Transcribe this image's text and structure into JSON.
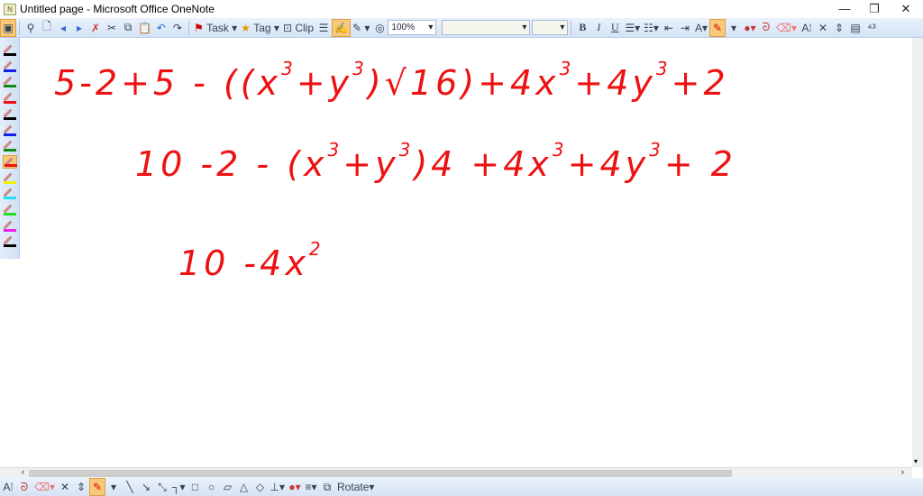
{
  "window": {
    "title": "Untitled page - Microsoft Office OneNote",
    "minimize": "—",
    "restore": "❐",
    "close": "✕"
  },
  "toolbar": {
    "task_label": "Task",
    "tag_label": "Tag",
    "clip_label": "Clip",
    "zoom_value": "100%",
    "font_value": "",
    "size_value": "",
    "bold": "B",
    "italic": "I",
    "underline": "U"
  },
  "pens": [
    {
      "color": "#000000"
    },
    {
      "color": "#1a1aee"
    },
    {
      "color": "#118811"
    },
    {
      "color": "#ee1111"
    },
    {
      "color": "#000000"
    },
    {
      "color": "#1a1aee"
    },
    {
      "color": "#118811"
    },
    {
      "color": "#ee1111",
      "selected": true
    },
    {
      "color": "#f0f000"
    },
    {
      "color": "#22e0f0"
    },
    {
      "color": "#22dd22"
    },
    {
      "color": "#ee22ee"
    },
    {
      "color": "#000000"
    }
  ],
  "ink": {
    "line1": {
      "a": "5-2+5 - ((x",
      "b": "3",
      "c": "+y",
      "d": "3",
      "e": ")√16)+4x",
      "f": "3",
      "g": "+4y",
      "h": "3",
      "i": "+2"
    },
    "line2": {
      "a": "10 -2 - (x",
      "b": "3",
      "c": "+y",
      "d": "3",
      "e": ")4 +4x",
      "f": "3",
      "g": "+4y",
      "h": "3",
      "i": "+ 2"
    },
    "line3": {
      "a": "10 -4x",
      "b": "2"
    }
  },
  "bottom": {
    "rotate_label": "Rotate"
  },
  "accent_color": "#ee1111"
}
